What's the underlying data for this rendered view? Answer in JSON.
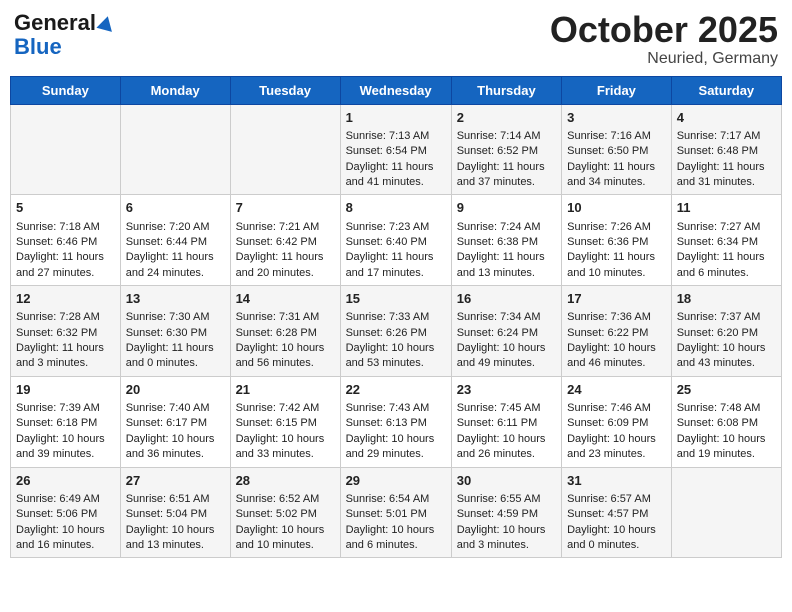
{
  "header": {
    "logo_general": "General",
    "logo_blue": "Blue",
    "title": "October 2025",
    "subtitle": "Neuried, Germany"
  },
  "days_of_week": [
    "Sunday",
    "Monday",
    "Tuesday",
    "Wednesday",
    "Thursday",
    "Friday",
    "Saturday"
  ],
  "weeks": [
    [
      {
        "day": "",
        "info": ""
      },
      {
        "day": "",
        "info": ""
      },
      {
        "day": "",
        "info": ""
      },
      {
        "day": "1",
        "info": "Sunrise: 7:13 AM\nSunset: 6:54 PM\nDaylight: 11 hours and 41 minutes."
      },
      {
        "day": "2",
        "info": "Sunrise: 7:14 AM\nSunset: 6:52 PM\nDaylight: 11 hours and 37 minutes."
      },
      {
        "day": "3",
        "info": "Sunrise: 7:16 AM\nSunset: 6:50 PM\nDaylight: 11 hours and 34 minutes."
      },
      {
        "day": "4",
        "info": "Sunrise: 7:17 AM\nSunset: 6:48 PM\nDaylight: 11 hours and 31 minutes."
      }
    ],
    [
      {
        "day": "5",
        "info": "Sunrise: 7:18 AM\nSunset: 6:46 PM\nDaylight: 11 hours and 27 minutes."
      },
      {
        "day": "6",
        "info": "Sunrise: 7:20 AM\nSunset: 6:44 PM\nDaylight: 11 hours and 24 minutes."
      },
      {
        "day": "7",
        "info": "Sunrise: 7:21 AM\nSunset: 6:42 PM\nDaylight: 11 hours and 20 minutes."
      },
      {
        "day": "8",
        "info": "Sunrise: 7:23 AM\nSunset: 6:40 PM\nDaylight: 11 hours and 17 minutes."
      },
      {
        "day": "9",
        "info": "Sunrise: 7:24 AM\nSunset: 6:38 PM\nDaylight: 11 hours and 13 minutes."
      },
      {
        "day": "10",
        "info": "Sunrise: 7:26 AM\nSunset: 6:36 PM\nDaylight: 11 hours and 10 minutes."
      },
      {
        "day": "11",
        "info": "Sunrise: 7:27 AM\nSunset: 6:34 PM\nDaylight: 11 hours and 6 minutes."
      }
    ],
    [
      {
        "day": "12",
        "info": "Sunrise: 7:28 AM\nSunset: 6:32 PM\nDaylight: 11 hours and 3 minutes."
      },
      {
        "day": "13",
        "info": "Sunrise: 7:30 AM\nSunset: 6:30 PM\nDaylight: 11 hours and 0 minutes."
      },
      {
        "day": "14",
        "info": "Sunrise: 7:31 AM\nSunset: 6:28 PM\nDaylight: 10 hours and 56 minutes."
      },
      {
        "day": "15",
        "info": "Sunrise: 7:33 AM\nSunset: 6:26 PM\nDaylight: 10 hours and 53 minutes."
      },
      {
        "day": "16",
        "info": "Sunrise: 7:34 AM\nSunset: 6:24 PM\nDaylight: 10 hours and 49 minutes."
      },
      {
        "day": "17",
        "info": "Sunrise: 7:36 AM\nSunset: 6:22 PM\nDaylight: 10 hours and 46 minutes."
      },
      {
        "day": "18",
        "info": "Sunrise: 7:37 AM\nSunset: 6:20 PM\nDaylight: 10 hours and 43 minutes."
      }
    ],
    [
      {
        "day": "19",
        "info": "Sunrise: 7:39 AM\nSunset: 6:18 PM\nDaylight: 10 hours and 39 minutes."
      },
      {
        "day": "20",
        "info": "Sunrise: 7:40 AM\nSunset: 6:17 PM\nDaylight: 10 hours and 36 minutes."
      },
      {
        "day": "21",
        "info": "Sunrise: 7:42 AM\nSunset: 6:15 PM\nDaylight: 10 hours and 33 minutes."
      },
      {
        "day": "22",
        "info": "Sunrise: 7:43 AM\nSunset: 6:13 PM\nDaylight: 10 hours and 29 minutes."
      },
      {
        "day": "23",
        "info": "Sunrise: 7:45 AM\nSunset: 6:11 PM\nDaylight: 10 hours and 26 minutes."
      },
      {
        "day": "24",
        "info": "Sunrise: 7:46 AM\nSunset: 6:09 PM\nDaylight: 10 hours and 23 minutes."
      },
      {
        "day": "25",
        "info": "Sunrise: 7:48 AM\nSunset: 6:08 PM\nDaylight: 10 hours and 19 minutes."
      }
    ],
    [
      {
        "day": "26",
        "info": "Sunrise: 6:49 AM\nSunset: 5:06 PM\nDaylight: 10 hours and 16 minutes."
      },
      {
        "day": "27",
        "info": "Sunrise: 6:51 AM\nSunset: 5:04 PM\nDaylight: 10 hours and 13 minutes."
      },
      {
        "day": "28",
        "info": "Sunrise: 6:52 AM\nSunset: 5:02 PM\nDaylight: 10 hours and 10 minutes."
      },
      {
        "day": "29",
        "info": "Sunrise: 6:54 AM\nSunset: 5:01 PM\nDaylight: 10 hours and 6 minutes."
      },
      {
        "day": "30",
        "info": "Sunrise: 6:55 AM\nSunset: 4:59 PM\nDaylight: 10 hours and 3 minutes."
      },
      {
        "day": "31",
        "info": "Sunrise: 6:57 AM\nSunset: 4:57 PM\nDaylight: 10 hours and 0 minutes."
      },
      {
        "day": "",
        "info": ""
      }
    ]
  ]
}
